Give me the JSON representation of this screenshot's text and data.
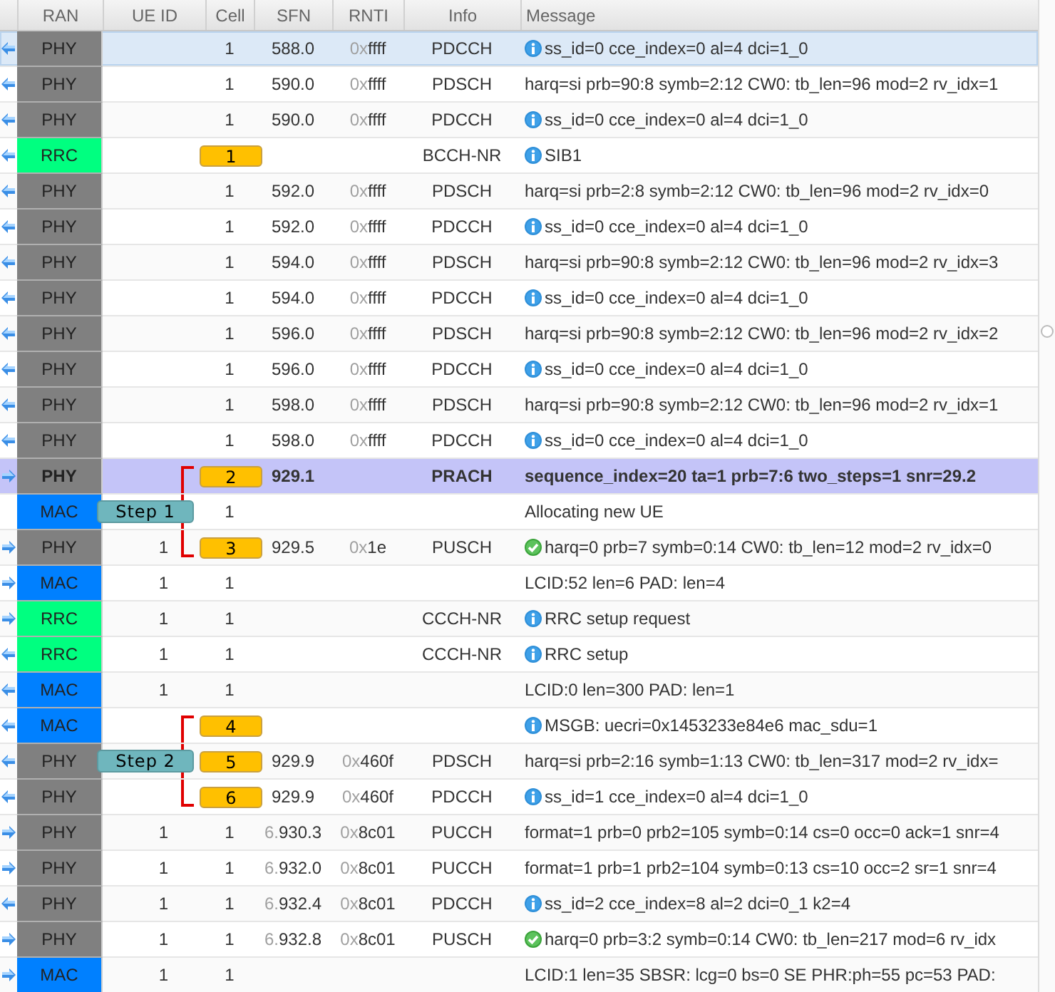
{
  "columns": [
    "RAN",
    "UE ID",
    "Cell",
    "SFN",
    "RNTI",
    "Info",
    "Message"
  ],
  "rows": [
    {
      "uplink": false,
      "ran": "PHY",
      "color": "#808080",
      "cell": "1",
      "sfn": "588.0",
      "rnti_prefix": "0x",
      "rnti": "ffff",
      "info": "PDCCH",
      "message": {
        "kind": "info",
        "text": "ss_id=0 cce_index=0 al=4 dci=1_0"
      },
      "selected": false,
      "focused": true
    },
    {
      "uplink": false,
      "ran": "PHY",
      "color": "#808080",
      "cell": "1",
      "sfn": "590.0",
      "rnti_prefix": "0x",
      "rnti": "ffff",
      "info": "PDSCH",
      "message": {
        "kind": "plain",
        "text": "harq=si prb=90:8 symb=2:12 CW0: tb_len=96 mod=2 rv_idx=1"
      },
      "selected": false,
      "focused": false
    },
    {
      "uplink": false,
      "ran": "PHY",
      "color": "#808080",
      "cell": "1",
      "sfn": "590.0",
      "rnti_prefix": "0x",
      "rnti": "ffff",
      "info": "PDCCH",
      "message": {
        "kind": "info",
        "text": "ss_id=0 cce_index=0 al=4 dci=1_0"
      },
      "selected": false,
      "focused": false
    },
    {
      "uplink": false,
      "ran": "RRC",
      "color": "#00ff80",
      "marker": "1",
      "info": "BCCH-NR",
      "message": {
        "kind": "info",
        "text": "SIB1"
      },
      "selected": false,
      "focused": false
    },
    {
      "uplink": false,
      "ran": "PHY",
      "color": "#808080",
      "cell": "1",
      "sfn": "592.0",
      "rnti_prefix": "0x",
      "rnti": "ffff",
      "info": "PDSCH",
      "message": {
        "kind": "plain",
        "text": "harq=si prb=2:8 symb=2:12 CW0: tb_len=96 mod=2 rv_idx=0"
      },
      "selected": false,
      "focused": false
    },
    {
      "uplink": false,
      "ran": "PHY",
      "color": "#808080",
      "cell": "1",
      "sfn": "592.0",
      "rnti_prefix": "0x",
      "rnti": "ffff",
      "info": "PDCCH",
      "message": {
        "kind": "info",
        "text": "ss_id=0 cce_index=0 al=4 dci=1_0"
      },
      "selected": false,
      "focused": false
    },
    {
      "uplink": false,
      "ran": "PHY",
      "color": "#808080",
      "cell": "1",
      "sfn": "594.0",
      "rnti_prefix": "0x",
      "rnti": "ffff",
      "info": "PDSCH",
      "message": {
        "kind": "plain",
        "text": "harq=si prb=90:8 symb=2:12 CW0: tb_len=96 mod=2 rv_idx=3"
      },
      "selected": false,
      "focused": false
    },
    {
      "uplink": false,
      "ran": "PHY",
      "color": "#808080",
      "cell": "1",
      "sfn": "594.0",
      "rnti_prefix": "0x",
      "rnti": "ffff",
      "info": "PDCCH",
      "message": {
        "kind": "info",
        "text": "ss_id=0 cce_index=0 al=4 dci=1_0"
      },
      "selected": false,
      "focused": false
    },
    {
      "uplink": false,
      "ran": "PHY",
      "color": "#808080",
      "cell": "1",
      "sfn": "596.0",
      "rnti_prefix": "0x",
      "rnti": "ffff",
      "info": "PDSCH",
      "message": {
        "kind": "plain",
        "text": "harq=si prb=90:8 symb=2:12 CW0: tb_len=96 mod=2 rv_idx=2"
      },
      "selected": false,
      "focused": false
    },
    {
      "uplink": false,
      "ran": "PHY",
      "color": "#808080",
      "cell": "1",
      "sfn": "596.0",
      "rnti_prefix": "0x",
      "rnti": "ffff",
      "info": "PDCCH",
      "message": {
        "kind": "info",
        "text": "ss_id=0 cce_index=0 al=4 dci=1_0"
      },
      "selected": false,
      "focused": false
    },
    {
      "uplink": false,
      "ran": "PHY",
      "color": "#808080",
      "cell": "1",
      "sfn": "598.0",
      "rnti_prefix": "0x",
      "rnti": "ffff",
      "info": "PDSCH",
      "message": {
        "kind": "plain",
        "text": "harq=si prb=90:8 symb=2:12 CW0: tb_len=96 mod=2 rv_idx=1"
      },
      "selected": false,
      "focused": false
    },
    {
      "uplink": false,
      "ran": "PHY",
      "color": "#808080",
      "cell": "1",
      "sfn": "598.0",
      "rnti_prefix": "0x",
      "rnti": "ffff",
      "info": "PDCCH",
      "message": {
        "kind": "info",
        "text": "ss_id=0 cce_index=0 al=4 dci=1_0"
      },
      "selected": false,
      "focused": false
    },
    {
      "uplink": true,
      "ran": "PHY",
      "color": "#808080",
      "marker": "2",
      "kind": "opener",
      "sfn": "929.1",
      "info": "PRACH",
      "message": {
        "kind": "plain",
        "text": "sequence_index=20 ta=1 prb=7:6 two_steps=1 snr=29.2"
      },
      "selected": true,
      "focused": false
    },
    {
      "ran": "MAC",
      "color": "#0080ff",
      "kind": "inner",
      "step": "Step 1",
      "cell": "1",
      "message": {
        "kind": "plain",
        "text": "Allocating new UE"
      },
      "selected": false,
      "focused": false
    },
    {
      "uplink": true,
      "ran": "PHY",
      "color": "#808080",
      "ue": "1",
      "marker": "3",
      "kind": "closer",
      "sfn": "929.5",
      "rnti_prefix": "0x",
      "rnti": "1e",
      "info": "PUSCH",
      "message": {
        "kind": "ok",
        "text": "harq=0 prb=7 symb=0:14 CW0: tb_len=12 mod=2 rv_idx=0"
      },
      "selected": false,
      "focused": false
    },
    {
      "uplink": true,
      "ran": "MAC",
      "color": "#0080ff",
      "ue": "1",
      "cell": "1",
      "message": {
        "kind": "plain",
        "text": "LCID:52 len=6 PAD: len=4"
      },
      "selected": false,
      "focused": false
    },
    {
      "uplink": true,
      "ran": "RRC",
      "color": "#00ff80",
      "ue": "1",
      "cell": "1",
      "info": "CCCH-NR",
      "message": {
        "kind": "info",
        "text": "RRC setup request"
      },
      "selected": false,
      "focused": false
    },
    {
      "uplink": false,
      "ran": "RRC",
      "color": "#00ff80",
      "ue": "1",
      "cell": "1",
      "info": "CCCH-NR",
      "message": {
        "kind": "info",
        "text": "RRC setup"
      },
      "selected": false,
      "focused": false
    },
    {
      "uplink": false,
      "ran": "MAC",
      "color": "#0080ff",
      "ue": "1",
      "cell": "1",
      "message": {
        "kind": "plain",
        "text": "LCID:0 len=300 PAD: len=1"
      },
      "selected": false,
      "focused": false
    },
    {
      "uplink": false,
      "ran": "MAC",
      "color": "#0080ff",
      "marker": "4",
      "kind": "opener",
      "message": {
        "kind": "info",
        "text": "MSGB: uecri=0x1453233e84e6 mac_sdu=1"
      },
      "selected": false,
      "focused": false
    },
    {
      "uplink": false,
      "ran": "PHY",
      "color": "#808080",
      "marker": "5",
      "kind": "inner",
      "step": "Step 2",
      "sfn": "929.9",
      "rnti_prefix": "0x",
      "rnti": "460f",
      "info": "PDSCH",
      "message": {
        "kind": "plain",
        "text": "harq=si prb=2:16 symb=1:13 CW0: tb_len=317 mod=2 rv_idx="
      },
      "selected": false,
      "focused": false
    },
    {
      "uplink": false,
      "ran": "PHY",
      "color": "#808080",
      "marker": "6",
      "kind": "closer",
      "sfn": "929.9",
      "rnti_prefix": "0x",
      "rnti": "460f",
      "info": "PDCCH",
      "message": {
        "kind": "info",
        "text": "ss_id=1 cce_index=0 al=4 dci=1_0"
      },
      "selected": false,
      "focused": false
    },
    {
      "uplink": true,
      "ran": "PHY",
      "color": "#808080",
      "ue": "1",
      "cell": "1",
      "sfn_prefix": "6.",
      "sfn": "930.3",
      "rnti_prefix": "0x",
      "rnti": "8c01",
      "info": "PUCCH",
      "message": {
        "kind": "plain",
        "text": "format=1 prb=0 prb2=105 symb=0:14 cs=0 occ=0 ack=1 snr=4"
      },
      "selected": false,
      "focused": false
    },
    {
      "uplink": true,
      "ran": "PHY",
      "color": "#808080",
      "ue": "1",
      "cell": "1",
      "sfn_prefix": "6.",
      "sfn": "932.0",
      "rnti_prefix": "0x",
      "rnti": "8c01",
      "info": "PUCCH",
      "message": {
        "kind": "plain",
        "text": "format=1 prb=1 prb2=104 symb=0:13 cs=10 occ=2 sr=1 snr=4"
      },
      "selected": false,
      "focused": false
    },
    {
      "uplink": false,
      "ran": "PHY",
      "color": "#808080",
      "ue": "1",
      "cell": "1",
      "sfn_prefix": "6.",
      "sfn": "932.4",
      "rnti_prefix": "0x",
      "rnti": "8c01",
      "info": "PDCCH",
      "message": {
        "kind": "info",
        "text": "ss_id=2 cce_index=8 al=2 dci=0_1 k2=4"
      },
      "selected": false,
      "focused": false
    },
    {
      "uplink": true,
      "ran": "PHY",
      "color": "#808080",
      "ue": "1",
      "cell": "1",
      "sfn_prefix": "6.",
      "sfn": "932.8",
      "rnti_prefix": "0x",
      "rnti": "8c01",
      "info": "PUSCH",
      "message": {
        "kind": "ok",
        "text": "harq=0 prb=3:2 symb=0:14 CW0: tb_len=217 mod=6 rv_idx"
      },
      "selected": false,
      "focused": false
    },
    {
      "uplink": true,
      "ran": "MAC",
      "color": "#0080ff",
      "ue": "1",
      "cell": "1",
      "message": {
        "kind": "plain",
        "text": "LCID:1 len=35 SBSR: lcg=0 bs=0 SE PHR:ph=55 pc=53 PAD:"
      },
      "selected": false,
      "focused": false
    }
  ]
}
